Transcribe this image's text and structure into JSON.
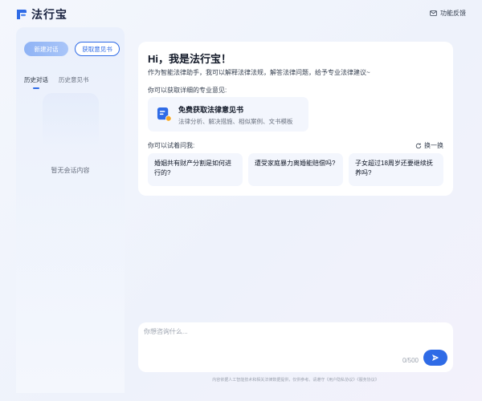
{
  "header": {
    "brand_name": "法行宝",
    "feedback_label": "功能反馈"
  },
  "sidebar": {
    "new_chat_label": "新建对话",
    "get_opinion_label": "获取意见书",
    "tabs": [
      {
        "label": "历史对话",
        "active": true
      },
      {
        "label": "历史意见书",
        "active": false
      }
    ],
    "empty_text": "暂无会话内容"
  },
  "main": {
    "greeting": "Hi，我是法行宝！",
    "intro": "作为智能法律助手，我可以解释法律法规，解答法律问题，给予专业法律建议~",
    "opinion_prompt": "你可以获取详细的专业意见:",
    "feature": {
      "title": "免费获取法律意见书",
      "subtitle": "法律分析、解决措施、相似案例、文书模板"
    },
    "ask_prompt": "你可以试着问我:",
    "refresh_label": "换一换",
    "questions": [
      "婚姻共有财产分割是如何进行的?",
      "遭受家庭暴力离婚能赔偿吗?",
      "子女超过18周岁还要继续抚养吗?"
    ]
  },
  "input": {
    "placeholder": "你想咨询什么...",
    "counter": "0/500"
  },
  "disclaimer": "内容依据人工智能技术和相关法律数据提供，仅供参考。请遵守《用户隐私协议》《服务协议》",
  "colors": {
    "accent": "#2f6be6",
    "card_bg": "#ffffff",
    "chip_bg": "#f3f6fd",
    "sidebar_bg": "#eaf0fc"
  }
}
